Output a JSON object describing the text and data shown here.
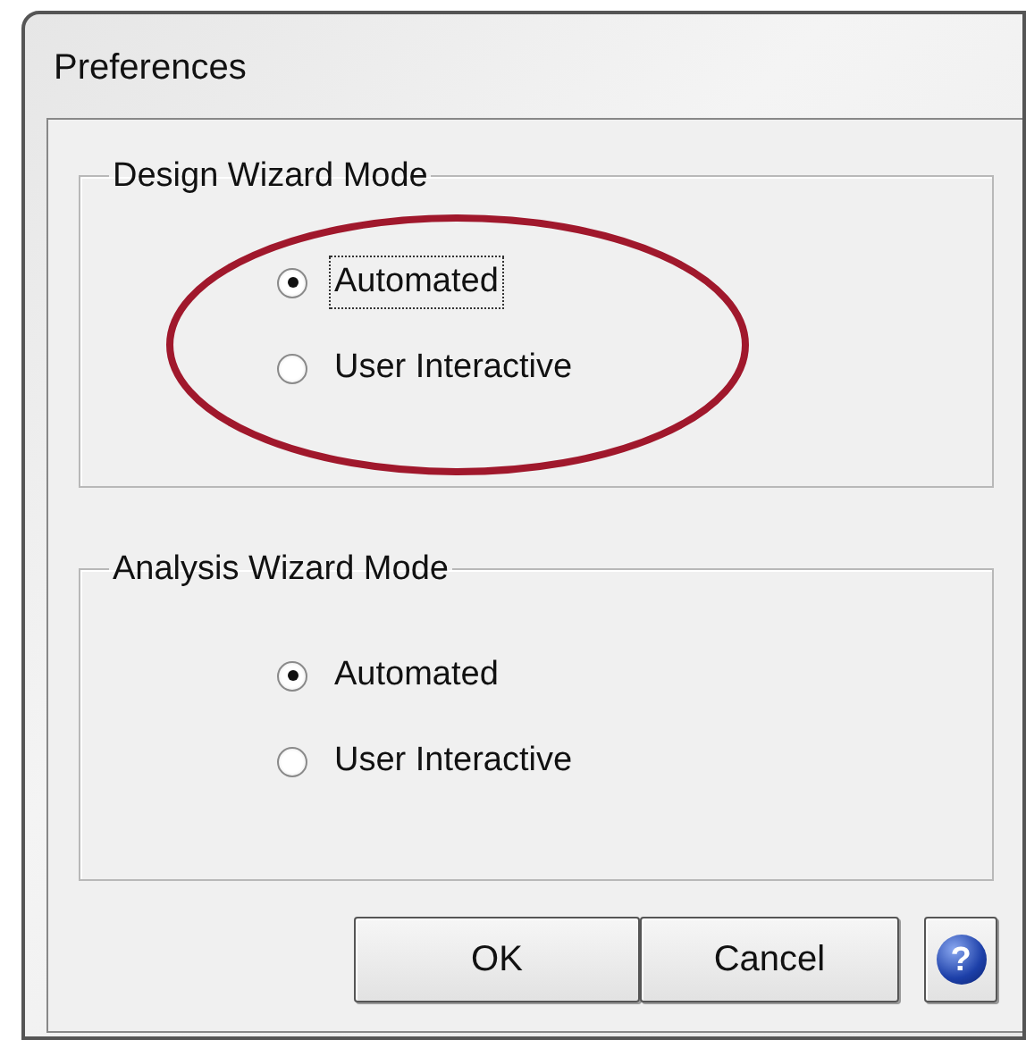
{
  "window": {
    "title": "Preferences"
  },
  "groups": [
    {
      "title": "Design Wizard Mode",
      "highlighted": true,
      "options": [
        {
          "label": "Automated",
          "selected": true,
          "focused": true
        },
        {
          "label": "User Interactive",
          "selected": false,
          "focused": false
        }
      ]
    },
    {
      "title": "Analysis Wizard Mode",
      "highlighted": false,
      "options": [
        {
          "label": "Automated",
          "selected": true,
          "focused": false
        },
        {
          "label": "User Interactive",
          "selected": false,
          "focused": false
        }
      ]
    }
  ],
  "buttons": [
    {
      "kind": "text",
      "label": "OK"
    },
    {
      "kind": "text",
      "label": "Cancel"
    },
    {
      "kind": "help",
      "label": "?"
    }
  ]
}
